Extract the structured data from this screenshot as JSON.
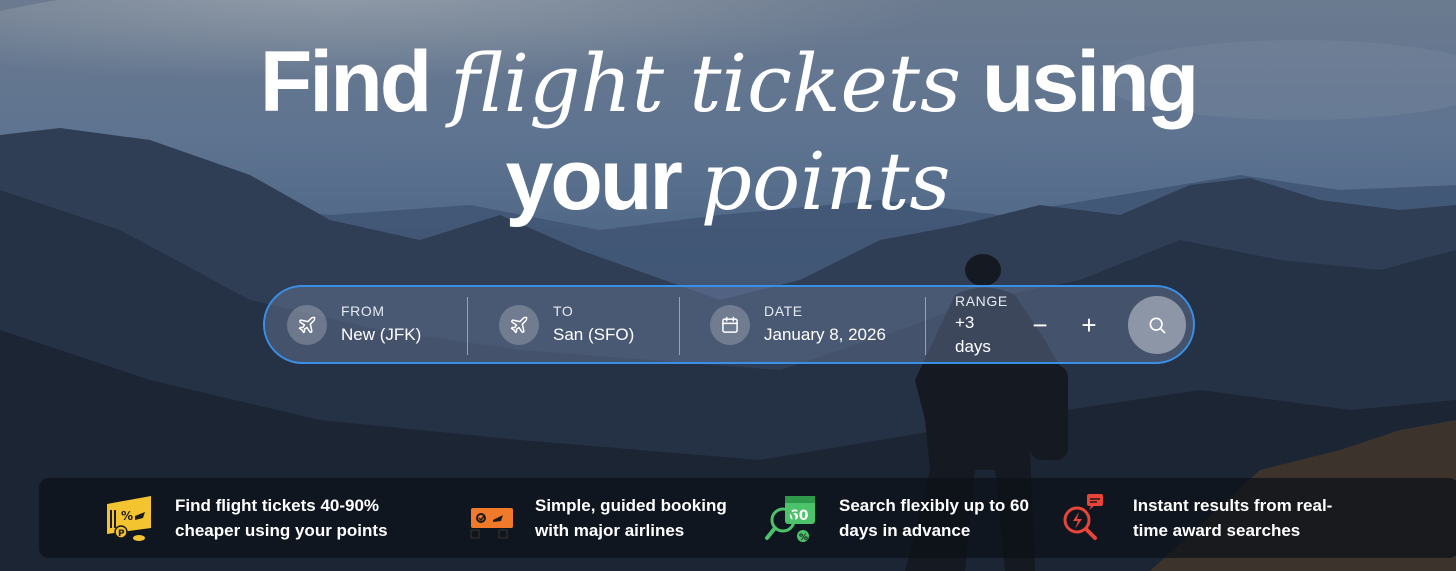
{
  "headline": {
    "line1_pre": "Find",
    "line1_serif": "flight tickets",
    "line1_post": "using",
    "line2_pre": "your",
    "line2_serif": "points"
  },
  "search": {
    "from": {
      "label": "FROM",
      "value": "New (JFK)",
      "icon": "plane-icon"
    },
    "to": {
      "label": "TO",
      "value": "San (SFO)",
      "icon": "plane-icon"
    },
    "date": {
      "label": "DATE",
      "value": "January 8, 2026",
      "icon": "calendar-icon"
    },
    "range": {
      "label": "RANGE",
      "value_line1": "+3",
      "value_line2": "days",
      "minus": "−",
      "plus": "+"
    },
    "submit_icon": "search-icon",
    "accent": "#3a8fe6"
  },
  "features": [
    {
      "text": "Find flight tickets 40-90% cheaper using your points",
      "icon": "points-ticket-icon",
      "color": "#f4c430"
    },
    {
      "text": "Simple, guided booking with major airlines",
      "icon": "boarding-pass-icon",
      "color": "#f07a2a"
    },
    {
      "text": "Search flexibly up to 60 days in advance",
      "icon": "calendar-60-icon",
      "color": "#4cc36b"
    },
    {
      "text": "Instant results from real-time award searches",
      "icon": "instant-search-icon",
      "color": "#e8443a"
    }
  ]
}
